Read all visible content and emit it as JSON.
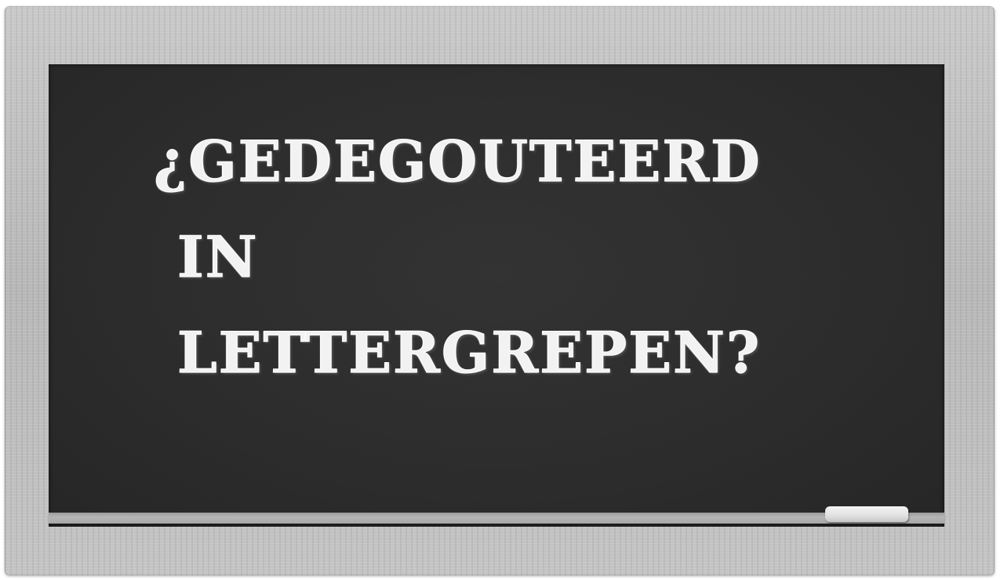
{
  "chalkboard": {
    "lines": [
      "¿GEDEGOUTEERD",
      "IN",
      "LETTERGREPEN?"
    ]
  }
}
